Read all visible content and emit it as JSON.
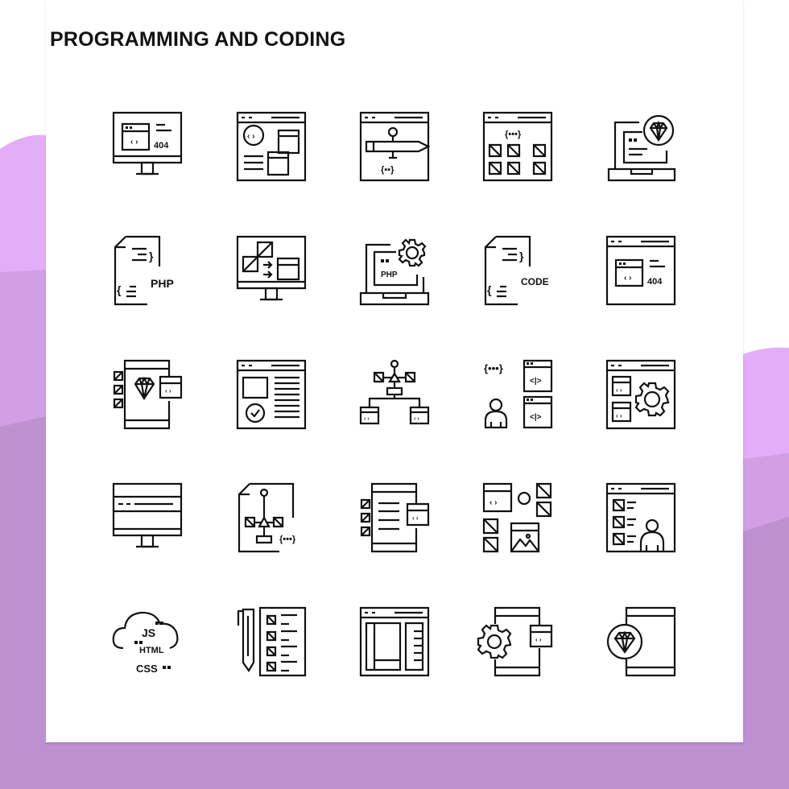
{
  "title": "PROGRAMMING AND CODING",
  "colors": {
    "background_light": "#e3aef7",
    "background_mid": "#d19fe4",
    "background_dark": "#be8fd1",
    "card": "#ffffff",
    "stroke": "#111111"
  },
  "icons": [
    {
      "name": "monitor-404-icon",
      "text": "404"
    },
    {
      "name": "browser-code-layout-icon"
    },
    {
      "name": "browser-pen-tool-icon",
      "text": "{▪▪}"
    },
    {
      "name": "browser-grid-brackets-icon",
      "text": "{•••}"
    },
    {
      "name": "laptop-diamond-icon"
    },
    {
      "name": "php-file-icon",
      "text": "PHP"
    },
    {
      "name": "monitor-transform-icon"
    },
    {
      "name": "laptop-php-gear-icon",
      "text": "PHP"
    },
    {
      "name": "code-file-icon",
      "text": "CODE"
    },
    {
      "name": "browser-404-icon",
      "text": "404"
    },
    {
      "name": "mobile-diamond-code-icon"
    },
    {
      "name": "browser-approved-content-icon"
    },
    {
      "name": "vector-hierarchy-icon"
    },
    {
      "name": "developer-code-windows-icon",
      "text": "{•••}"
    },
    {
      "name": "browser-code-gear-icon"
    },
    {
      "name": "monitor-browser-icon"
    },
    {
      "name": "file-vector-brackets-icon",
      "text": "{•••}"
    },
    {
      "name": "mobile-checklist-code-icon"
    },
    {
      "name": "code-shapes-image-icon"
    },
    {
      "name": "browser-user-list-icon"
    },
    {
      "name": "cloud-web-languages-icon",
      "text_js": "JS",
      "text_html": "HTML",
      "text_css": "CSS"
    },
    {
      "name": "pencil-checklist-icon"
    },
    {
      "name": "browser-layout-icon"
    },
    {
      "name": "mobile-gear-code-icon"
    },
    {
      "name": "mobile-diamond-icon"
    }
  ]
}
